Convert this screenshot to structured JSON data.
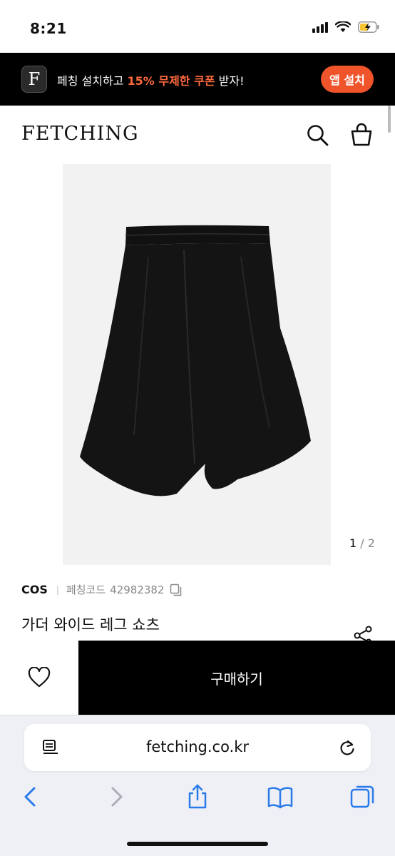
{
  "status_bar": {
    "time": "8:21",
    "signal_icon": "cellular-signal-icon",
    "wifi_icon": "wifi-icon",
    "battery_icon": "battery-charging-icon"
  },
  "app_banner": {
    "logo_letter": "F",
    "text_prefix": "페칭 설치하고 ",
    "text_highlight": "15% 무제한 쿠폰",
    "text_suffix": " 받자!",
    "install_label": "앱 설치",
    "accent_color": "#f0542a"
  },
  "header": {
    "logo": "FETCHING",
    "search_icon": "search-icon",
    "cart_icon": "shopping-bag-icon"
  },
  "product": {
    "image_counter_current": "1",
    "image_counter_total": " / 2",
    "brand": "COS",
    "code_label": "페칭코드",
    "code_value": "42982382",
    "title": "가더 와이드 레그 쇼츠",
    "image_alt": "black wide leg shorts"
  },
  "buy_bar": {
    "buy_label": "구매하기",
    "wish_icon": "heart-icon"
  },
  "browser": {
    "url": "fetching.co.kr",
    "toolbar_icons": [
      "back-icon",
      "forward-icon",
      "share-icon",
      "bookmarks-icon",
      "tabs-icon"
    ]
  }
}
